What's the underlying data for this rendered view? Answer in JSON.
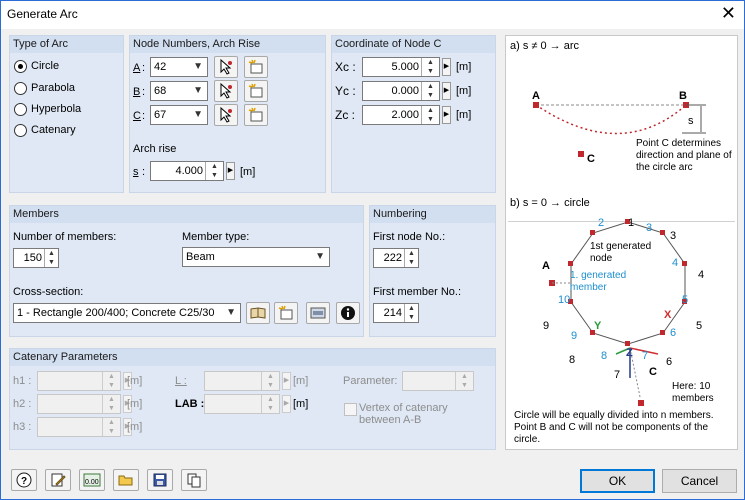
{
  "window": {
    "title": "Generate Arc",
    "close_glyph": "✕"
  },
  "type_of_arc": {
    "header": "Type of Arc",
    "options": [
      {
        "label": "Circle",
        "selected": true
      },
      {
        "label": "Parabola",
        "selected": false
      },
      {
        "label": "Hyperbola",
        "selected": false
      },
      {
        "label": "Catenary",
        "selected": false
      }
    ]
  },
  "node_numbers": {
    "header": "Node Numbers, Arch Rise",
    "a_label": "A",
    "b_label": "B",
    "c_label": "C",
    "a_value": "42",
    "b_value": "68",
    "c_value": "67",
    "arch_rise_label": "Arch rise",
    "s_label": "s",
    "s_value": "4.000",
    "s_unit": "[m]"
  },
  "coordinate_c": {
    "header": "Coordinate of Node C",
    "xc_label": "Xc :",
    "yc_label": "Yc :",
    "zc_label": "Zc :",
    "xc_value": "5.000",
    "yc_value": "0.000",
    "zc_value": "2.000",
    "unit": "[m]"
  },
  "members": {
    "header": "Members",
    "count_label": "Number of members:",
    "count_value": "150",
    "type_label": "Member type:",
    "type_value": "Beam",
    "cross_section_label": "Cross-section:",
    "cross_section_value": "1 - Rectangle 200/400; Concrete C25/30"
  },
  "numbering": {
    "header": "Numbering",
    "first_node_label": "First node No.:",
    "first_node_value": "222",
    "first_member_label": "First member No.:",
    "first_member_value": "214"
  },
  "catenary": {
    "header": "Catenary Parameters",
    "h1_label": "h1 :",
    "h2_label": "h2 :",
    "h3_label": "h3 :",
    "unit": "[m]",
    "l_label": "L :",
    "lab_label": "LAB :",
    "parameter_label": "Parameter:",
    "vertex_label": "Vertex of catenary between A-B"
  },
  "diagram": {
    "top_caption": "a) s ≠ 0 → arc",
    "point_a": "A",
    "point_b": "B",
    "point_c": "C",
    "s_mark": "s",
    "arc_note": "Point C determines direction and plane of the circle arc",
    "bottom_caption": "b) s = 0 → circle",
    "first_node_note": "1st generated node",
    "first_member_note": "1. generated member",
    "here_note": "Here: 10 members",
    "footer_note": "Circle will be equally divided into n members. Point B and C will not be components of the circle.",
    "axis_x": "X",
    "axis_y": "Y",
    "axis_z": "Z",
    "node_numbers": [
      "1",
      "2",
      "3",
      "4",
      "5",
      "6",
      "7",
      "8",
      "9",
      "10"
    ],
    "member_numbers": [
      "1",
      "2",
      "3",
      "4",
      "5",
      "6",
      "7",
      "8",
      "9",
      "10"
    ]
  },
  "buttons": {
    "ok": "OK",
    "cancel": "Cancel"
  },
  "colors": {
    "accent": "#0078d7",
    "node": "#c0282d",
    "member_label": "#1d8fd0",
    "group_bg": "#dfe8f4"
  }
}
